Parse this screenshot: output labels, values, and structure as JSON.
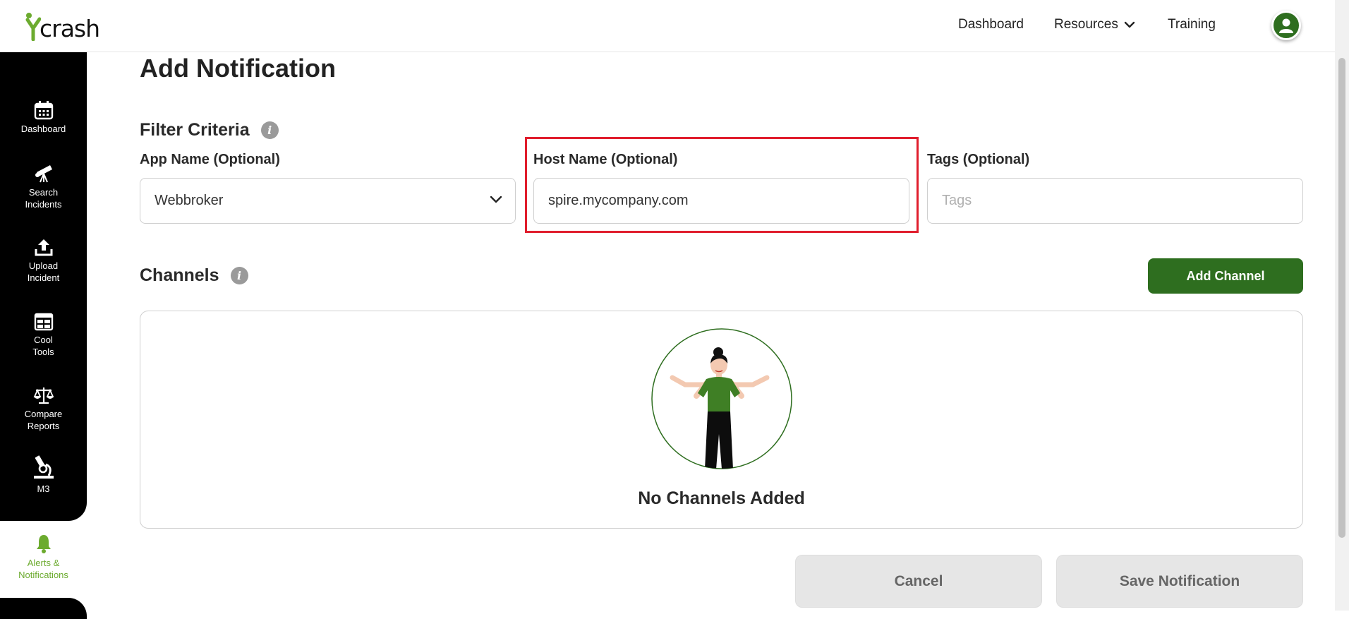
{
  "app": {
    "logo_text": "crash"
  },
  "topnav": {
    "dashboard": "Dashboard",
    "resources": "Resources",
    "training": "Training"
  },
  "sidebar": {
    "items": [
      {
        "label": "Dashboard",
        "icon": "calendar-icon"
      },
      {
        "label": "Search\nIncidents",
        "icon": "telescope-icon"
      },
      {
        "label": "Upload\nIncident",
        "icon": "upload-icon"
      },
      {
        "label": "Cool\nTools",
        "icon": "grid-tools-icon"
      },
      {
        "label": "Compare\nReports",
        "icon": "scales-icon"
      },
      {
        "label": "M3",
        "icon": "microscope-icon"
      }
    ],
    "active": {
      "label": "Alerts &\nNotifications",
      "icon": "bell-icon"
    }
  },
  "page": {
    "title": "Add Notification"
  },
  "filter": {
    "title": "Filter Criteria",
    "app_name_label": "App Name (Optional)",
    "app_name_value": "Webbroker",
    "host_name_label": "Host Name (Optional)",
    "host_name_value": "spire.mycompany.com",
    "tags_label": "Tags (Optional)",
    "tags_placeholder": "Tags"
  },
  "channels": {
    "title": "Channels",
    "add_label": "Add Channel",
    "empty_text": "No Channels Added"
  },
  "actions": {
    "cancel_label": "Cancel",
    "save_label": "Save Notification"
  },
  "colors": {
    "brand_green": "#2e6e1f",
    "accent_green": "#6cab2f",
    "highlight_red": "#e01e2d"
  }
}
